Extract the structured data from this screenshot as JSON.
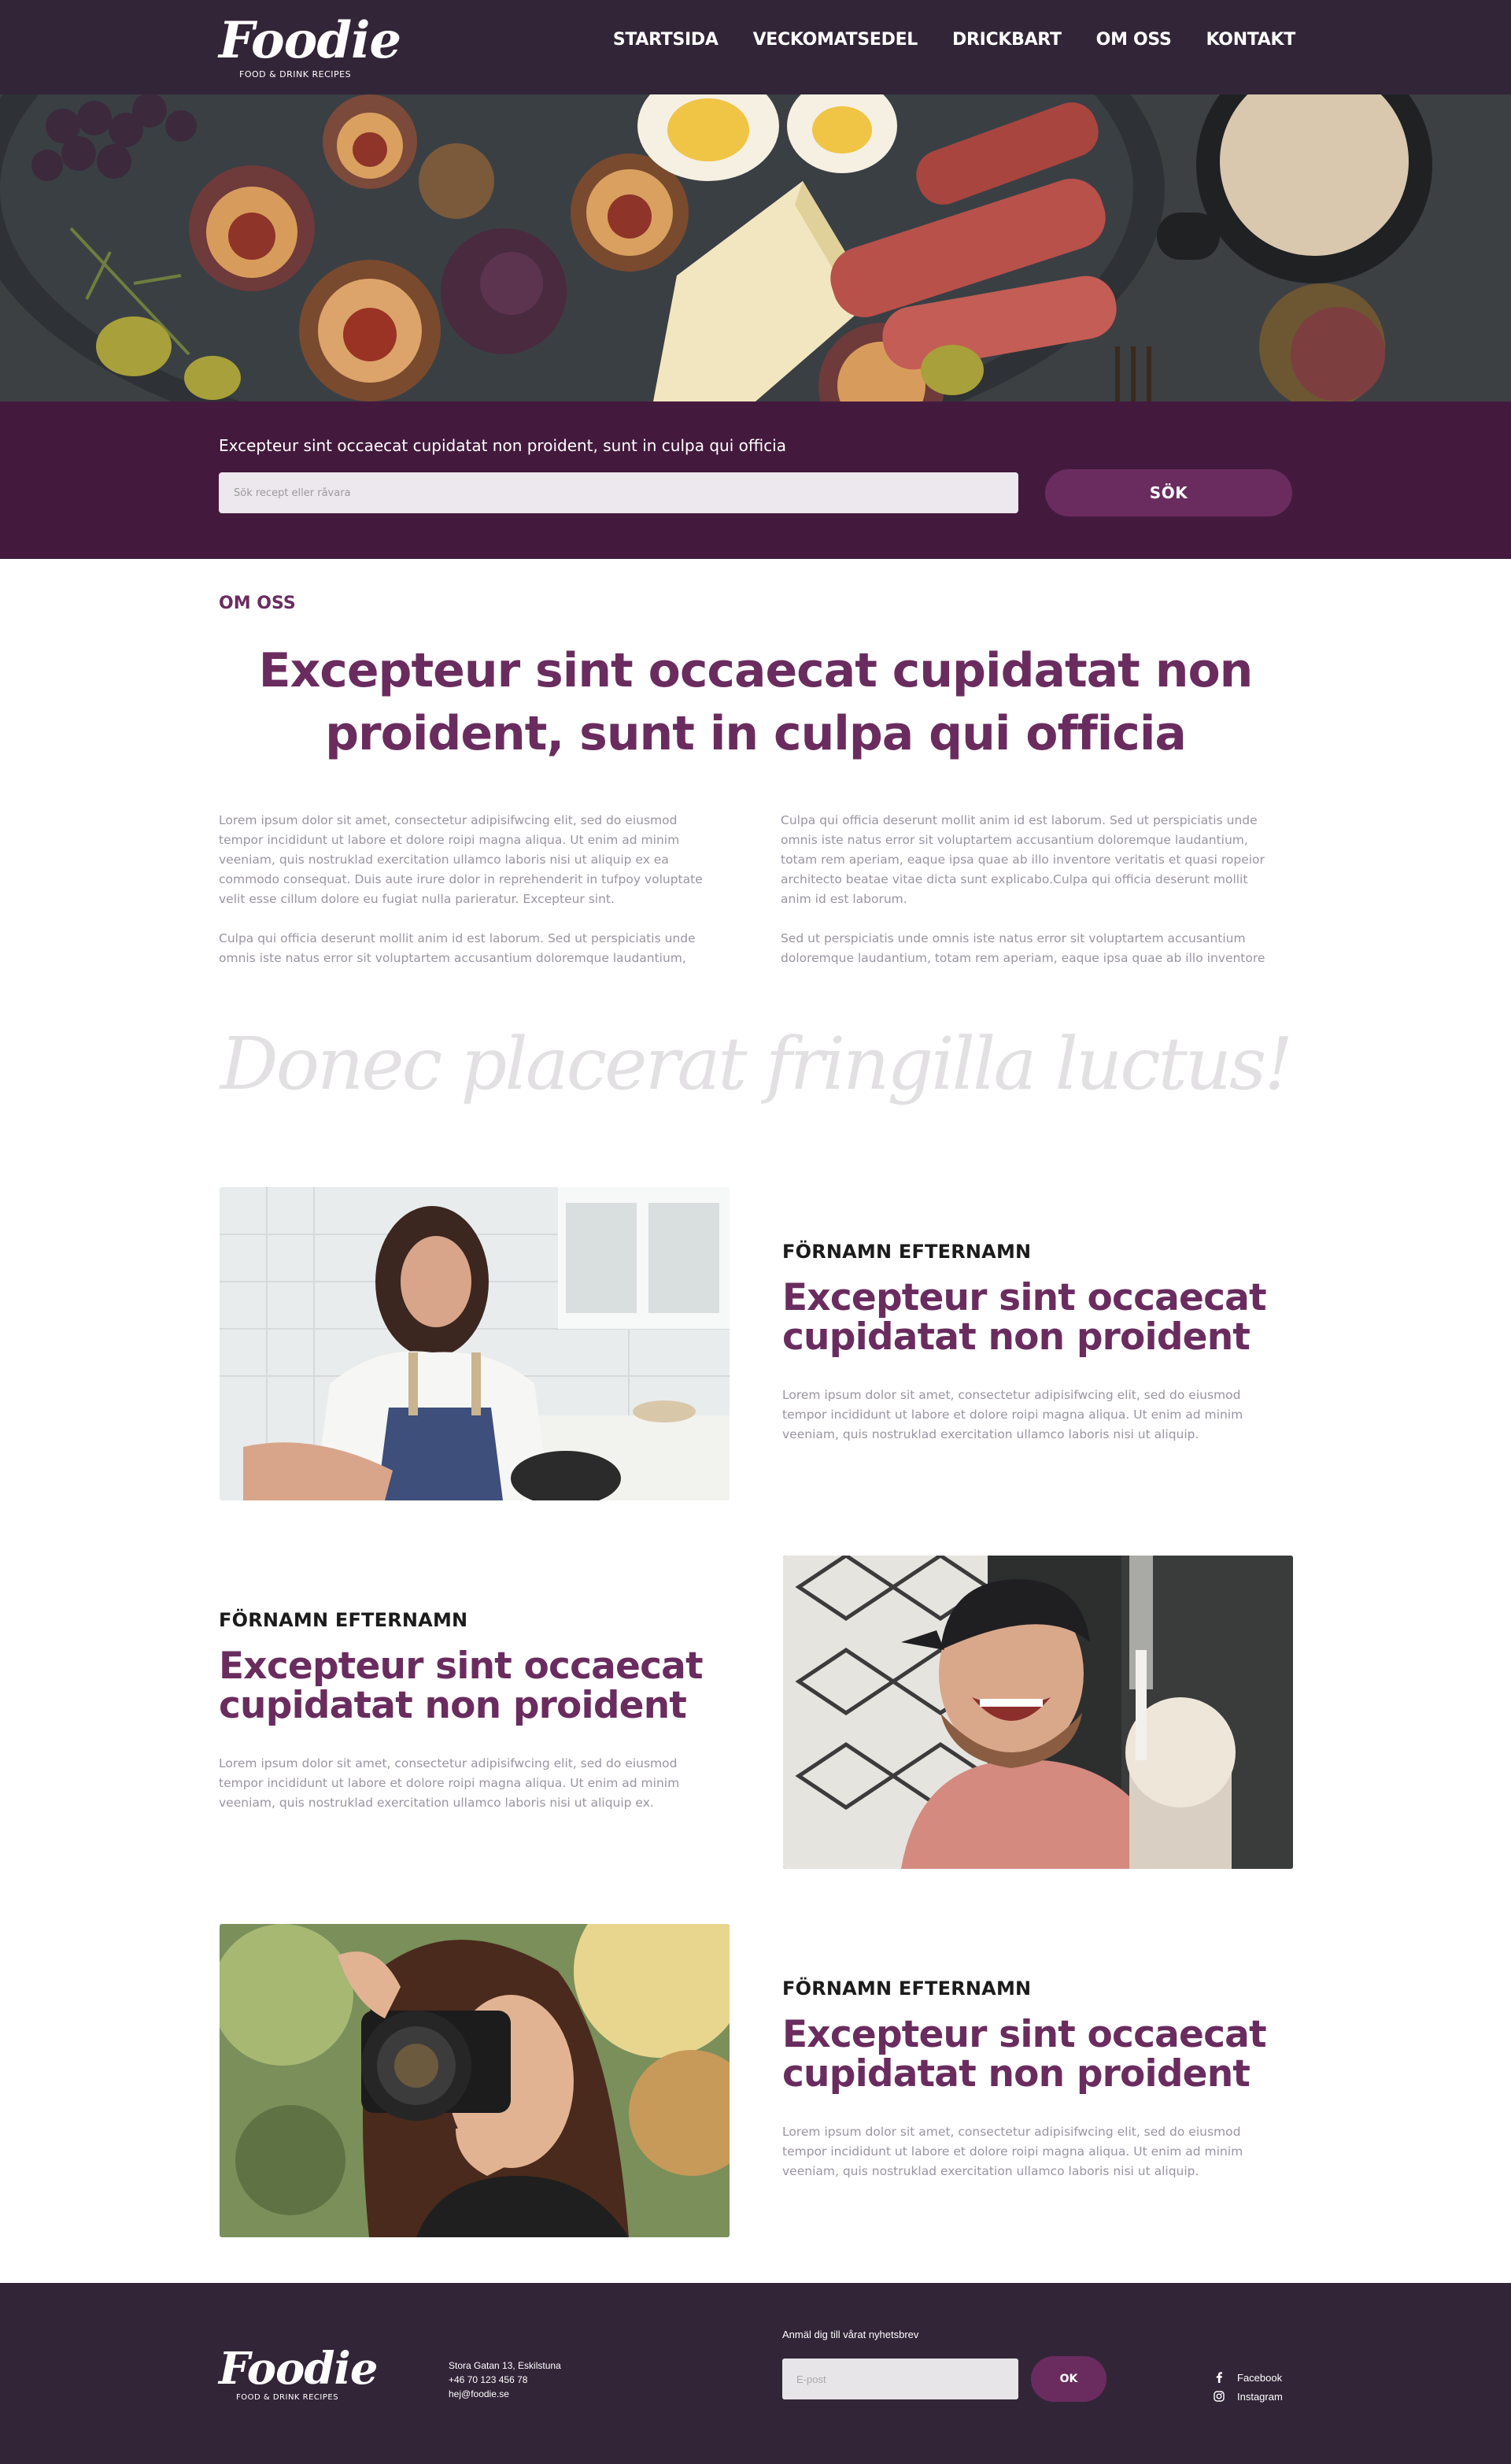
{
  "brand": {
    "name": "Foodie",
    "tagline": "FOOD & DRINK RECIPES"
  },
  "nav": {
    "items": [
      {
        "label": "STARTSIDA"
      },
      {
        "label": "VECKOMATSEDEL"
      },
      {
        "label": "DRICKBART"
      },
      {
        "label": "OM OSS"
      },
      {
        "label": "KONTAKT"
      }
    ]
  },
  "search": {
    "caption": "Excepteur sint occaecat cupidatat non proident, sunt in culpa qui officia",
    "placeholder": "Sök recept eller råvara",
    "button_label": "SÖK"
  },
  "about": {
    "label": "OM OSS",
    "heading": "Excepteur sint occaecat cupidatat non proident, sunt in culpa qui officia",
    "left": {
      "p1": "Lorem ipsum dolor sit amet, consectetur adipisifwcing elit, sed do eiusmod tempor incididunt ut labore et dolore roipi magna aliqua. Ut enim ad minim veeniam, quis nostruklad exercitation ullamco laboris nisi ut aliquip ex ea commodo consequat. Duis aute irure dolor in reprehenderit in tufpoy voluptate velit esse cillum dolore eu fugiat nulla parieratur. Excepteur sint.",
      "p2": "Culpa qui officia deserunt mollit anim id est laborum. Sed ut perspiciatis unde omnis iste natus error sit voluptartem accusantium doloremque laudantium,"
    },
    "right": {
      "p1": "Culpa qui officia deserunt mollit anim id est laborum. Sed ut perspiciatis unde omnis iste natus error sit voluptartem accusantium doloremque laudantium, totam rem aperiam, eaque ipsa quae ab illo inventore veritatis et quasi ropeior architecto beatae vitae dicta sunt explicabo.Culpa qui officia deserunt mollit anim id est laborum.",
      "p2": "Sed ut perspiciatis unde omnis iste natus error sit voluptartem accusantium doloremque laudantium, totam rem aperiam, eaque ipsa quae ab illo inventore"
    }
  },
  "quote": "Donec placerat fringilla luctus!",
  "profiles": [
    {
      "name": "FÖRNAMN EFTERNAMN",
      "heading": "Excepteur sint occaecat cupidatat non proident",
      "body": "Lorem ipsum dolor sit amet, consectetur adipisifwcing elit, sed do eiusmod tempor incididunt ut labore et dolore roipi magna aliqua. Ut enim ad minim veeniam, quis nostruklad exercitation ullamco laboris nisi ut aliquip."
    },
    {
      "name": "FÖRNAMN EFTERNAMN",
      "heading": "Excepteur sint occaecat cupidatat non proident",
      "body": "Lorem ipsum dolor sit amet, consectetur adipisifwcing elit, sed do eiusmod tempor incididunt ut labore et dolore roipi magna aliqua. Ut enim ad minim veeniam, quis nostruklad exercitation ullamco laboris nisi ut aliquip ex."
    },
    {
      "name": "FÖRNAMN EFTERNAMN",
      "heading": "Excepteur sint occaecat cupidatat non proident",
      "body": "Lorem ipsum dolor sit amet, consectetur adipisifwcing elit, sed do eiusmod tempor incididunt ut labore et dolore roipi magna aliqua. Ut enim ad minim veeniam, quis nostruklad exercitation ullamco laboris nisi ut aliquip."
    }
  ],
  "footer": {
    "address": "Stora Gatan 13, Eskilstuna",
    "phone": "+46 70 123 456 78",
    "email": "hej@foodie.se",
    "newsletter_label": "Anmäl dig till vårat nyhetsbrev",
    "email_placeholder": "E-post",
    "ok_label": "OK",
    "social": [
      {
        "label": "Facebook",
        "icon": "facebook-icon"
      },
      {
        "label": "Instagram",
        "icon": "instagram-icon"
      }
    ]
  },
  "colors": {
    "header_bg": "#332538",
    "search_band_bg": "#431a3e",
    "accent": "#6a2c5f",
    "body_text": "#9a94a0"
  }
}
